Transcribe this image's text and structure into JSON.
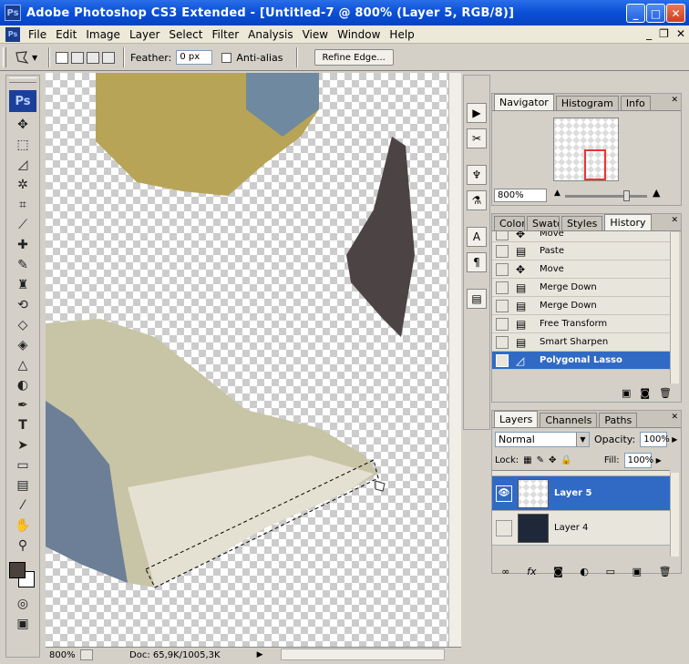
{
  "window": {
    "title": "Adobe Photoshop CS3 Extended - [Untitled-7 @ 800% (Layer 5, RGB/8)]",
    "app_badge": "Ps"
  },
  "menu": [
    "File",
    "Edit",
    "Image",
    "Layer",
    "Select",
    "Filter",
    "Analysis",
    "View",
    "Window",
    "Help"
  ],
  "options": {
    "feather_label": "Feather:",
    "feather_value": "0 px",
    "antialias_label": "Anti-alias",
    "refine_label": "Refine Edge..."
  },
  "toolbox": {
    "logo": "Ps"
  },
  "status": {
    "zoom": "800%",
    "doc": "Doc: 65,9K/1005,3K"
  },
  "navigator": {
    "tabs": [
      "Navigator",
      "Histogram",
      "Info"
    ],
    "zoom": "800%"
  },
  "history": {
    "tabs": [
      "Color",
      "Swatc",
      "Styles",
      "History"
    ],
    "items": [
      "Move",
      "Paste",
      "Move",
      "Merge Down",
      "Merge Down",
      "Free Transform",
      "Smart Sharpen",
      "Polygonal Lasso"
    ],
    "active_index": 7
  },
  "layers": {
    "tabs": [
      "Layers",
      "Channels",
      "Paths"
    ],
    "blend_mode": "Normal",
    "opacity_label": "Opacity:",
    "opacity": "100%",
    "lock_label": "Lock:",
    "fill_label": "Fill:",
    "fill": "100%",
    "rows": [
      "Layer 5",
      "Layer 4"
    ],
    "active_index": 0
  },
  "colors": {
    "selection": "#316ac5",
    "titlebar": "#0a4fd6"
  }
}
